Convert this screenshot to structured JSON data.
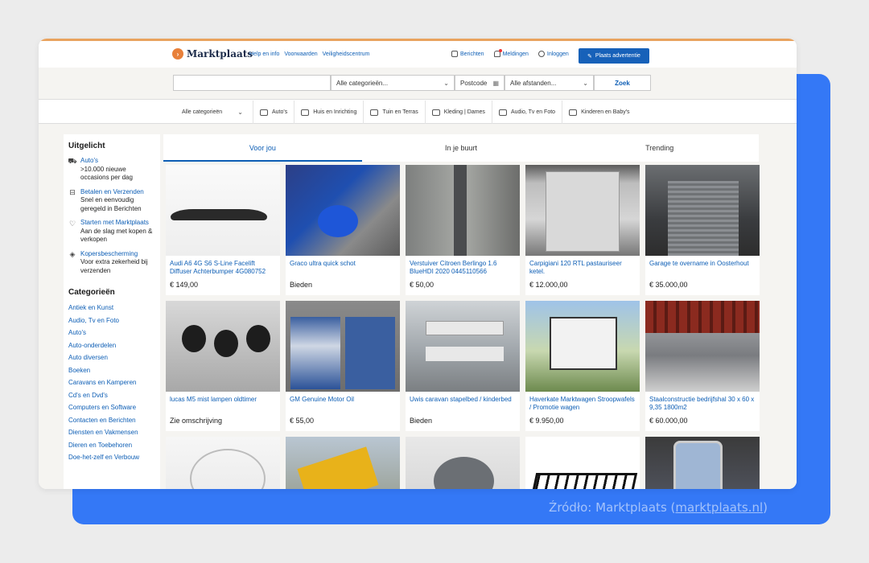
{
  "header": {
    "logo_text": "Marktplaats",
    "links": [
      "Help en info",
      "Voorwaarden",
      "Veiligheidscentrum"
    ],
    "right_links": [
      {
        "label": "Berichten",
        "icon": "chat-icon"
      },
      {
        "label": "Meldingen",
        "icon": "bell-icon"
      },
      {
        "label": "Inloggen",
        "icon": "user-icon"
      }
    ],
    "cta_label": "Plaats advertentie"
  },
  "search": {
    "query_value": "",
    "category_value": "Alle categorieën...",
    "postcode_placeholder": "Postcode",
    "distance_value": "Alle afstanden...",
    "submit_label": "Zoek"
  },
  "category_bar": {
    "first": "Alle categorieën",
    "items": [
      "Auto's",
      "Huis en Inrichting",
      "Tuin en Terras",
      "Kleding | Dames",
      "Audio, Tv en Foto",
      "Kinderen en Baby's"
    ]
  },
  "sidebar": {
    "featured_title": "Uitgelicht",
    "featured": [
      {
        "link": "Auto's",
        "text": ">10.000 nieuwe occasions per dag",
        "icon": "car-icon"
      },
      {
        "link": "Betalen en Verzenden",
        "text": "Snel en eenvoudig geregeld in Berichten",
        "icon": "payment-icon"
      },
      {
        "link": "Starten met Marktplaats",
        "text": "Aan de slag met kopen & verkopen",
        "icon": "heart-icon"
      },
      {
        "link": "Kopersbescherming",
        "text": "Voor extra zekerheid bij verzenden",
        "icon": "shield-icon"
      }
    ],
    "categories_title": "Categorieën",
    "categories": [
      "Antiek en Kunst",
      "Audio, Tv en Foto",
      "Auto's",
      "Auto-onderdelen",
      "Auto diversen",
      "Boeken",
      "Caravans en Kamperen",
      "Cd's en Dvd's",
      "Computers en Software",
      "Contacten en Berichten",
      "Diensten en Vakmensen",
      "Dieren en Toebehoren",
      "Doe-het-zelf en Verbouw"
    ]
  },
  "tabs": [
    {
      "label": "Voor jou",
      "active": true
    },
    {
      "label": "In je buurt",
      "active": false
    },
    {
      "label": "Trending",
      "active": false
    }
  ],
  "listings": [
    {
      "title": "Audi A6 4G S6 S-Line Facelift Diffuser Achterbumper 4G080752",
      "price": "€ 149,00",
      "img": "i1"
    },
    {
      "title": "Graco ultra quick schot",
      "price": "Bieden",
      "img": "i2"
    },
    {
      "title": "Verstuiver Citroen Berlingo 1.6 BlueHDI 2020 0445110566",
      "price": "€ 50,00",
      "img": "i3"
    },
    {
      "title": "Carpigiani 120 RTL pastauriseer ketel.",
      "price": "€ 12.000,00",
      "img": "i4"
    },
    {
      "title": "Garage te overname in Oosterhout",
      "price": "€ 35.000,00",
      "img": "i5"
    },
    {
      "title": "lucas M5 mist lampen oldtimer",
      "price": "Zie omschrijving",
      "img": "i6"
    },
    {
      "title": "GM Genuine Motor Oil",
      "price": "€ 55,00",
      "img": "i7"
    },
    {
      "title": "Uwis caravan stapelbed / kinderbed",
      "price": "Bieden",
      "img": "i8"
    },
    {
      "title": "Haverkate Marktwagen Stroopwafels / Promotie wagen",
      "price": "€ 9.950,00",
      "img": "i9"
    },
    {
      "title": "Staalconstructie bedrijfshal 30 x 60 x 9,35 1800m2",
      "price": "€ 60.000,00",
      "img": "i10"
    },
    {
      "title": "",
      "price": "",
      "img": "i11"
    },
    {
      "title": "",
      "price": "",
      "img": "i12"
    },
    {
      "title": "",
      "price": "",
      "img": "i13"
    },
    {
      "title": "",
      "price": "",
      "img": "i14"
    },
    {
      "title": "",
      "price": "",
      "img": "i15"
    }
  ],
  "source": {
    "prefix": "Źródło: Marktplaats (",
    "link": "marktplaats.nl",
    "suffix": ")"
  }
}
